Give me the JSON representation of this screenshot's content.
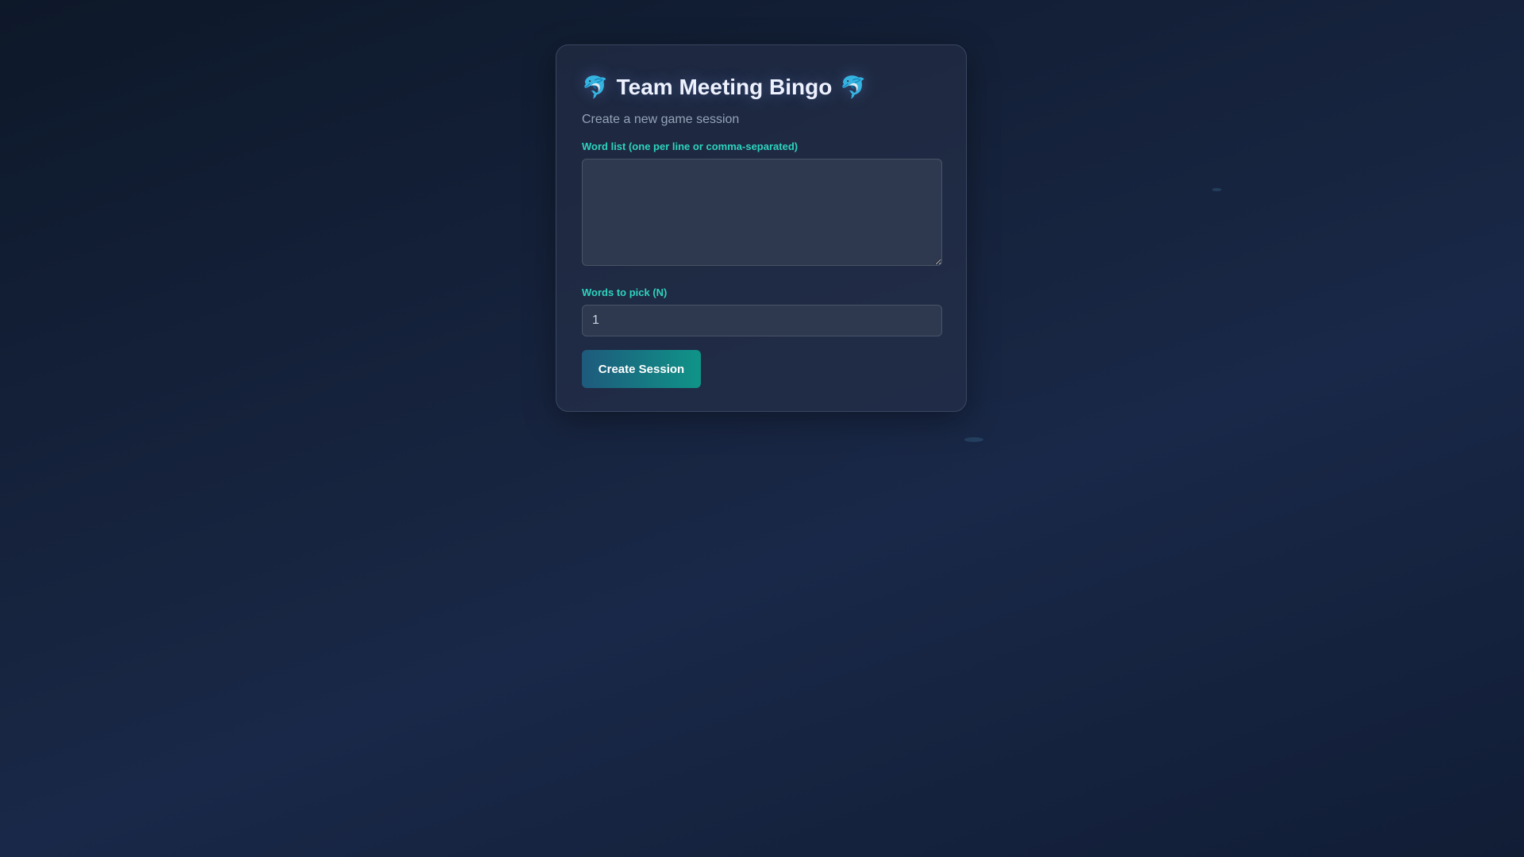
{
  "card": {
    "title": "Team Meeting Bingo",
    "title_emoji": "🐬",
    "subtitle": "Create a new game session",
    "word_list_label": "Word list (one per line or comma-separated)",
    "word_list_value": "",
    "words_to_pick_label": "Words to pick (N)",
    "words_to_pick_value": "1",
    "create_button": "Create Session"
  }
}
